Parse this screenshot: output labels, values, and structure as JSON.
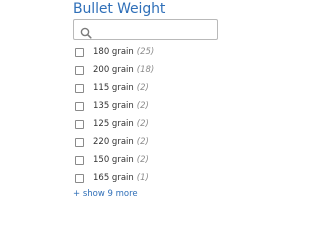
{
  "facet": {
    "title": "Bullet Weight",
    "search": {
      "value": "",
      "placeholder": ""
    },
    "options": [
      {
        "label": "180 grain",
        "count": "(25)",
        "checked": false
      },
      {
        "label": "200 grain",
        "count": "(18)",
        "checked": false
      },
      {
        "label": "115 grain",
        "count": "(2)",
        "checked": false
      },
      {
        "label": "135 grain",
        "count": "(2)",
        "checked": false
      },
      {
        "label": "125 grain",
        "count": "(2)",
        "checked": false
      },
      {
        "label": "220 grain",
        "count": "(2)",
        "checked": false
      },
      {
        "label": "150 grain",
        "count": "(2)",
        "checked": false
      },
      {
        "label": "165 grain",
        "count": "(1)",
        "checked": false
      }
    ],
    "show_more_label": "+ show 9 more"
  },
  "colors": {
    "accent": "#2f6fb8",
    "text": "#333333",
    "count": "#8c8c8c",
    "border": "#b9b9b9"
  },
  "icons": {
    "search": "search-icon",
    "checkbox": "checkbox-icon"
  }
}
